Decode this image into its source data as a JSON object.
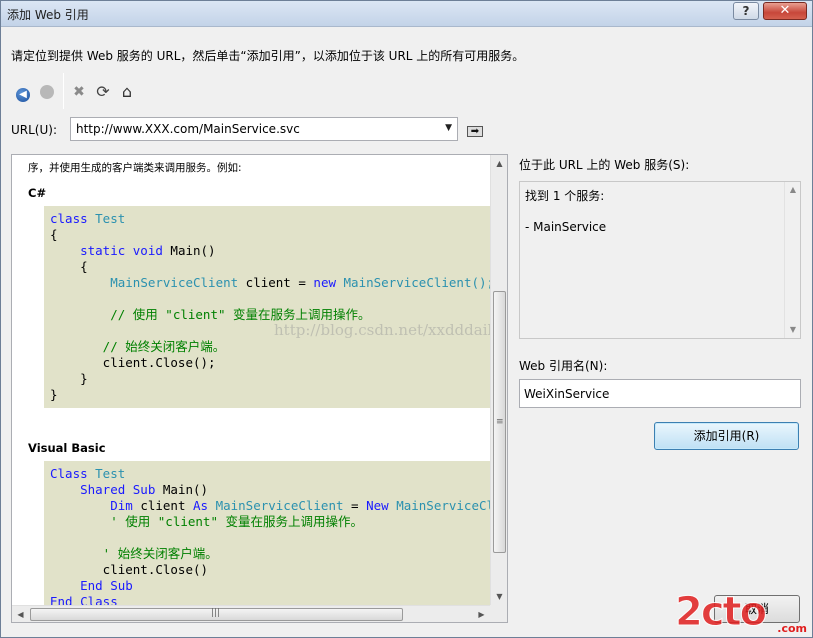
{
  "window": {
    "title": "添加 Web 引用",
    "help_label": "?",
    "close_label": "✕"
  },
  "instruction": "请定位到提供 Web 服务的 URL，然后单击“添加引用”，以添加位于该 URL 上的所有可用服务。",
  "toolbar": {
    "icons": [
      "back-icon",
      "stop-icon",
      "cancel-icon",
      "refresh-icon",
      "home-icon"
    ]
  },
  "url": {
    "label": "URL(U):",
    "value": "http://www.XXX.com/MainService.svc"
  },
  "browser": {
    "intro": "序，并使用生成的客户端类来调用服务。例如:",
    "csharp_heading": "C#",
    "vb_heading": "Visual Basic",
    "csharp_code": [
      {
        "tokens": [
          {
            "t": "class ",
            "c": "kw"
          },
          {
            "t": "Test",
            "c": "ty"
          }
        ]
      },
      {
        "tokens": [
          {
            "t": "{",
            "c": ""
          }
        ]
      },
      {
        "tokens": [
          {
            "t": "    static void ",
            "c": "kw"
          },
          {
            "t": "Main()",
            "c": ""
          }
        ]
      },
      {
        "tokens": [
          {
            "t": "    {",
            "c": ""
          }
        ]
      },
      {
        "tokens": [
          {
            "t": "        ",
            "c": ""
          },
          {
            "t": "MainServiceClient",
            "c": "ty"
          },
          {
            "t": " client = ",
            "c": ""
          },
          {
            "t": "new ",
            "c": "kw"
          },
          {
            "t": "MainServiceClient();",
            "c": "ty"
          }
        ]
      },
      {
        "tokens": [
          {
            "t": "",
            "c": ""
          }
        ]
      },
      {
        "tokens": [
          {
            "t": "        // 使用 \"client\" 变量在服务上调用操作。",
            "c": "cm"
          }
        ]
      },
      {
        "tokens": [
          {
            "t": "",
            "c": ""
          }
        ]
      },
      {
        "tokens": [
          {
            "t": "       // 始终关闭客户端。",
            "c": "cm"
          }
        ]
      },
      {
        "tokens": [
          {
            "t": "       client.Close();",
            "c": ""
          }
        ]
      },
      {
        "tokens": [
          {
            "t": "    }",
            "c": ""
          }
        ]
      },
      {
        "tokens": [
          {
            "t": "}",
            "c": ""
          }
        ]
      }
    ],
    "vb_code": [
      {
        "tokens": [
          {
            "t": "Class ",
            "c": "kw"
          },
          {
            "t": "Test",
            "c": "ty"
          }
        ]
      },
      {
        "tokens": [
          {
            "t": "    Shared Sub ",
            "c": "kw"
          },
          {
            "t": "Main()",
            "c": ""
          }
        ]
      },
      {
        "tokens": [
          {
            "t": "        Dim ",
            "c": "kw"
          },
          {
            "t": "client ",
            "c": ""
          },
          {
            "t": "As ",
            "c": "kw"
          },
          {
            "t": "MainServiceClient",
            "c": "ty"
          },
          {
            "t": " = ",
            "c": ""
          },
          {
            "t": "New ",
            "c": "kw"
          },
          {
            "t": "MainServiceClient()",
            "c": "ty"
          }
        ]
      },
      {
        "tokens": [
          {
            "t": "        ' 使用 \"client\" 变量在服务上调用操作。",
            "c": "cm"
          }
        ]
      },
      {
        "tokens": [
          {
            "t": "",
            "c": ""
          }
        ]
      },
      {
        "tokens": [
          {
            "t": "       ' 始终关闭客户端。",
            "c": "cm"
          }
        ]
      },
      {
        "tokens": [
          {
            "t": "       client.Close()",
            "c": ""
          }
        ]
      },
      {
        "tokens": [
          {
            "t": "    End Sub",
            "c": "kw"
          }
        ]
      },
      {
        "tokens": [
          {
            "t": "End Class",
            "c": "kw"
          }
        ]
      }
    ],
    "watermark": "http://blog.csdn.net/xxdddail"
  },
  "services": {
    "label": "位于此 URL 上的 Web 服务(S):",
    "found_text": "找到 1 个服务:",
    "items": [
      "- MainService"
    ]
  },
  "reference": {
    "label": "Web 引用名(N):",
    "value": "WeiXinService"
  },
  "buttons": {
    "add_label": "添加引用(R)",
    "cancel_label": "取消"
  },
  "logo": {
    "big": "2cto",
    "small": ".com"
  },
  "colors": {
    "code_bg": "#e1e2c9",
    "keyword": "#1a1aff",
    "type": "#2b91af",
    "comment": "#008000"
  }
}
